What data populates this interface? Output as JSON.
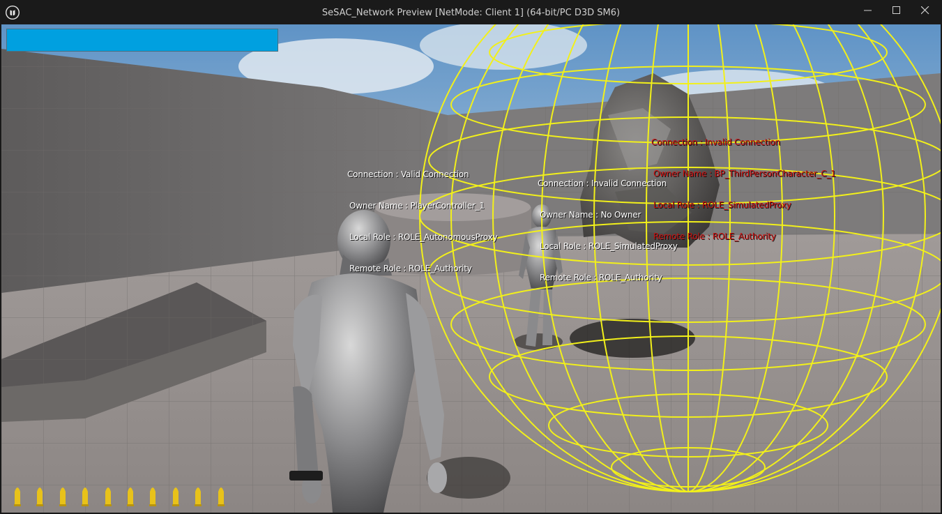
{
  "window": {
    "title": "SeSAC_Network Preview [NetMode: Client 1]  (64-bit/PC D3D SM6)",
    "controls": {
      "minimize": "minimize",
      "maximize": "maximize",
      "close": "close"
    }
  },
  "hud": {
    "health": {
      "fraction": 1.0,
      "color": "#00a0e0"
    },
    "ammo": {
      "count": 10,
      "color": "#e8c21a"
    }
  },
  "debug_overlays": [
    {
      "color": "#ffffff",
      "lines": [
        "Connection : Valid Connection",
        "Owner Name : PlayerController_1",
        "Local Role : ROLE_AutonomousProxy",
        "Remote Role : ROLE_Authority"
      ]
    },
    {
      "color": "#ffffff",
      "lines": [
        "Connection : Invalid Connection",
        "Owner Name : No Owner",
        "Local Role : ROLE_SimulatedProxy",
        "Remote Role : ROLE_Authority"
      ]
    },
    {
      "color": "#d01010",
      "lines": [
        "Connection : Invalid Connection",
        "Owner Name : BP_ThirdPersonCharacter_C_1",
        "Local Role : ROLE_SimulatedProxy",
        "Remote Role : ROLE_Authority"
      ]
    }
  ],
  "scene": {
    "sky_color": "#6f9ec9",
    "wireframe_sphere_color": "#f2f01a"
  }
}
